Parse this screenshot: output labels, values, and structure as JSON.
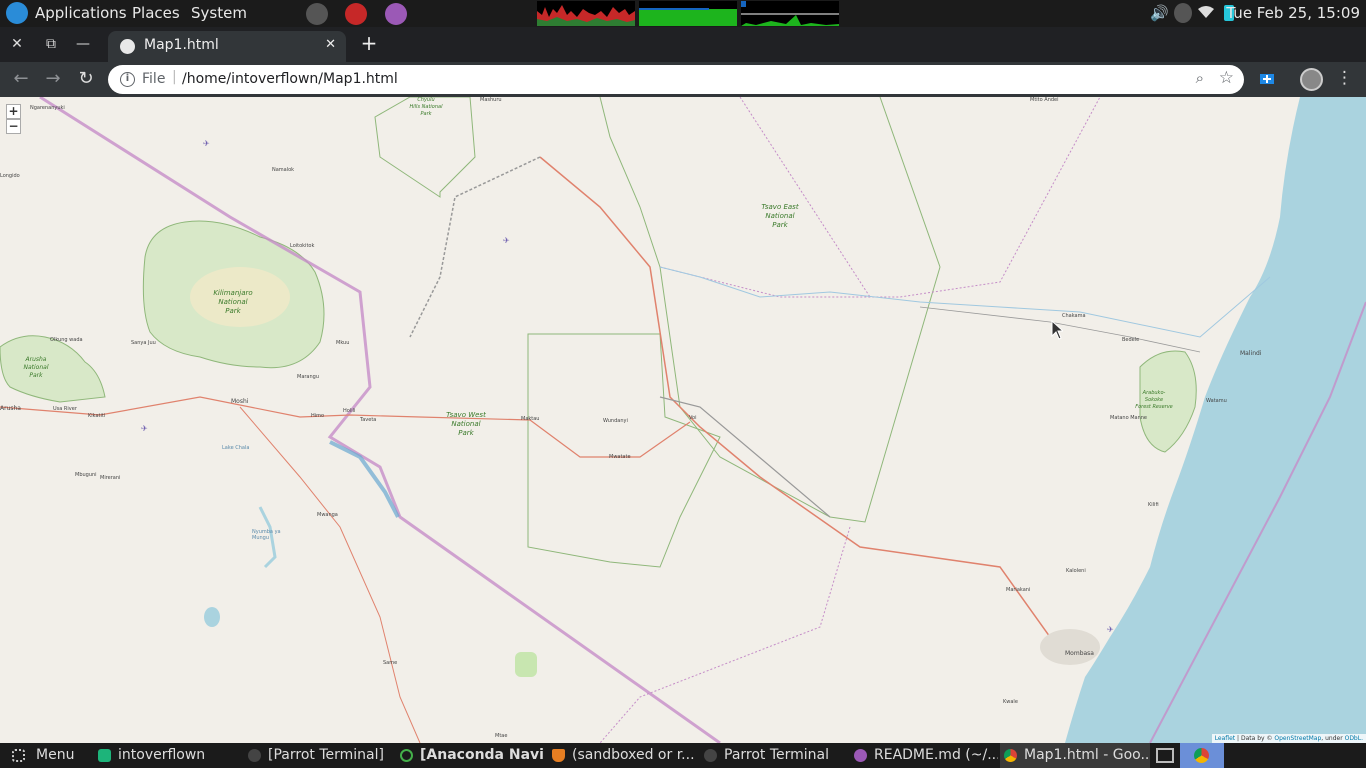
{
  "top_panel": {
    "menus": [
      "Applications",
      "Places",
      "System"
    ],
    "clock": "Tue Feb 25, 15:09"
  },
  "browser": {
    "tab_title": "Map1.html",
    "omnibox": {
      "scheme_label": "File",
      "url": "/home/intoverflown/Map1.html"
    }
  },
  "map": {
    "zoom_in": "+",
    "zoom_out": "−",
    "park_labels": {
      "tsavo_east": [
        "Tsavo East",
        "National",
        "Park"
      ],
      "tsavo_west": [
        "Tsavo West",
        "National",
        "Park"
      ],
      "kilimanjaro": [
        "Kilimanjaro",
        "National",
        "Park"
      ],
      "arusha": [
        "Arusha",
        "National",
        "Park"
      ],
      "chyulu": [
        "Chyulu",
        "Hills National",
        "Park"
      ],
      "arabuko": [
        "Arabuko-",
        "Sokoke",
        "Forest Reserve"
      ]
    },
    "places": {
      "namalok": "Namalok",
      "loitokitok": "Loitokitok",
      "mashuru": "Mashuru",
      "olkung": "Olkung wada",
      "sanya_juu": "Sanya Juu",
      "mkuu": "Mkuu",
      "marangu": "Marangu",
      "moshi": "Moshi",
      "himo": "Himo",
      "holili": "Holili",
      "taveta": "Taveta",
      "arusha": "Arusha",
      "usa_river": "Usa River",
      "kikatiti": "Kikatiti",
      "mbuguni": "Mbuguni",
      "mirerani": "Mirerani",
      "mwanga": "Mwanga",
      "same": "Same",
      "mtae": "Mtae",
      "maktau": "Maktau",
      "mwatate": "Mwatate",
      "wundanyi": "Wundanyi",
      "voi": "Voi",
      "chakama": "Chakama",
      "bedele": "Bedele",
      "malindi": "Malindi",
      "watamu": "Watamu",
      "mutano": "Matano Manne",
      "kilifi": "Kilifi",
      "kaloleni": "Kaloleni",
      "mariakani": "Mariakani",
      "mombasa": "Mombasa",
      "kwale": "Kwale",
      "nyumba": "Nyumba ya Mungu",
      "lake_chala": "Lake Chala",
      "ngarenanyuki": "Ngarenanyuki",
      "longido": "Longido",
      "makindu": "Mtito Andei"
    },
    "attribution": {
      "leaflet": "Leaflet",
      "mid": " | Data by © ",
      "osm": "OpenStreetMap",
      "under": ", under ",
      "odbl": "ODbL."
    }
  },
  "taskbar": {
    "items": [
      {
        "label": "Menu"
      },
      {
        "label": "intoverflown"
      },
      {
        "label": "[Parrot Terminal]"
      },
      {
        "label": "[Anaconda Navi..."
      },
      {
        "label": "(sandboxed or r..."
      },
      {
        "label": "Parrot Terminal"
      },
      {
        "label": "README.md (~/..."
      },
      {
        "label": "Map1.html - Goo..."
      }
    ]
  },
  "colors": {
    "map_land": "#f2efe9",
    "sea": "#aad3df",
    "park_fill": "#d8e8c8",
    "park_border": "#8fb77a",
    "border_purple": "#c58dc8",
    "road_red": "#e0826d",
    "river_blue": "#a0c8e0"
  }
}
